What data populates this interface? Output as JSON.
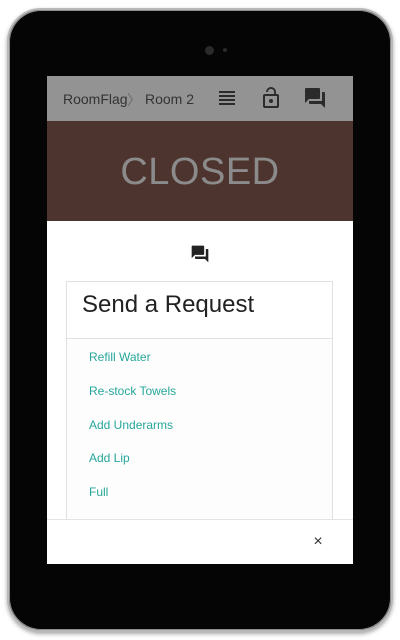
{
  "breadcrumb": {
    "app": "RoomFlag",
    "separator": "〉",
    "room": "Room 2"
  },
  "toolbar": {
    "icons": [
      "list-icon",
      "lock-open-icon",
      "forum-icon"
    ]
  },
  "status": {
    "text": "CLOSED",
    "background_color": "#4e342e",
    "text_color": "#8b8b8b"
  },
  "request_panel": {
    "icon": "forum-icon",
    "title": "Send a Request",
    "items": [
      {
        "label": "Refill Water"
      },
      {
        "label": "Re-stock Towels"
      },
      {
        "label": "Add Underarms"
      },
      {
        "label": "Add Lip"
      },
      {
        "label": "Full"
      }
    ],
    "link_color": "#26a69a"
  },
  "footer": {
    "close_label": "×"
  }
}
